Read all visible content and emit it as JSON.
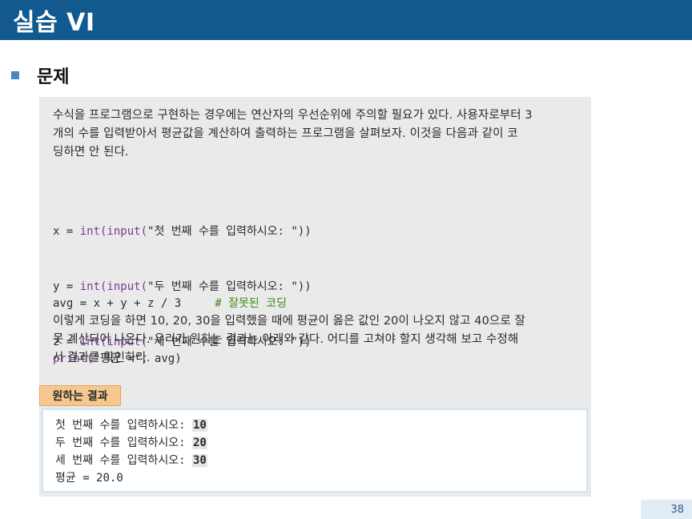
{
  "header": {
    "title": "실습 VI"
  },
  "section": {
    "heading": "문제"
  },
  "problem": {
    "intro_lines": [
      "수식을 프로그램으로 구현하는 경우에는 연산자의 우선순위에 주의할 필요가 있다. 사용자로부터 3",
      "개의 수를 입력받아서 평균값을 계산하여 출력하는 프로그램을 살펴보자. 이것을 다음과 같이 코",
      "딩하면 안 된다."
    ],
    "code_inputs": [
      {
        "var": "x = ",
        "func": "int(input(",
        "rest": "\"첫 번째 수를 입력하시오: \"))"
      },
      {
        "var": "y = ",
        "func": "int(input(",
        "rest": "\"두 번째 수를 입력하시오: \"))"
      },
      {
        "var": "z = ",
        "func": "int(input(",
        "rest": "\"세 번째 수를 입력하시오: \"))"
      }
    ],
    "code_avg": {
      "expr": "avg = x + y + z / 3     ",
      "comment": "# 잘못된 코딩"
    },
    "code_print": {
      "func": "print(",
      "rest": "\"평균 =\", avg)"
    },
    "explanation_lines": [
      "이렇게 코딩을 하면 10, 20, 30을 입력했을 때에 평균이 옳은 값인 20이 나오지 않고 40으로 잘",
      "못 계산되어 나온다. 우리가 원하는 결과는 아래와 같다. 어디를 고쳐야 할지 생각해 보고 수정해",
      "서 결과를 확인하라."
    ]
  },
  "result": {
    "tab_label": "원하는 결과",
    "lines": [
      {
        "prompt": "첫 번째 수를 입력하시오: ",
        "value": "10"
      },
      {
        "prompt": "두 번째 수를 입력하시오: ",
        "value": "20"
      },
      {
        "prompt": "세 번째 수를 입력하시오: ",
        "value": "30"
      }
    ],
    "final_line": "평균 = 20.0"
  },
  "footer": {
    "page_number": "38"
  },
  "colors": {
    "title_bar": "#12598f",
    "bullet": "#4a86c6",
    "content_background": "#eaeaea",
    "code_function": "#7a3a94",
    "code_comment": "#3c8a1e",
    "result_tab": "#f6c890",
    "page_number_background": "#e1ecf6"
  },
  "icons": {
    "section_bullet": "square-bullet-icon"
  }
}
